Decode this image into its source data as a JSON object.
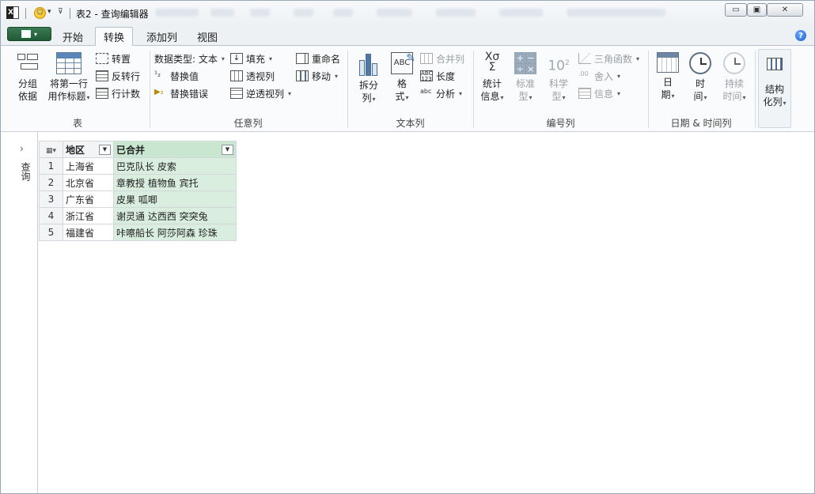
{
  "window": {
    "title": "表2 - 查询编辑器"
  },
  "tabs": [
    {
      "label": "开始"
    },
    {
      "label": "转换"
    },
    {
      "label": "添加列"
    },
    {
      "label": "视图"
    }
  ],
  "ribbon": {
    "table_group": {
      "label": "表",
      "group_by": "分组\n依据",
      "use_first_row_line1": "将第一行",
      "use_first_row_line2": "用作标题",
      "transpose": "转置",
      "reverse_rows": "反转行",
      "count_rows": "行计数"
    },
    "any_column_group": {
      "label": "任意列",
      "data_type": "数据类型: 文本",
      "replace_values": "替换值",
      "replace_errors": "替换错误",
      "fill": "填充",
      "pivot_column": "透视列",
      "unpivot_columns": "逆透视列",
      "rename": "重命名",
      "move": "移动"
    },
    "text_column_group": {
      "label": "文本列",
      "split_column_line1": "拆分",
      "split_column_line2": "列",
      "format_line1": "格",
      "format_line2": "式",
      "merge_columns": "合并列",
      "length": "长度",
      "parse": "分析"
    },
    "number_column_group": {
      "label": "编号列",
      "statistics_line1": "统计",
      "statistics_line2": "信息",
      "standard_line1": "标准",
      "standard_line2": "型",
      "scientific_line1": "科学",
      "scientific_line2": "型",
      "trigonometry": "三角函数",
      "rounding": "舍入",
      "information": "信息"
    },
    "datetime_group": {
      "label": "日期 & 时间列",
      "date_line1": "日",
      "date_line2": "期",
      "time_line1": "时",
      "time_line2": "间",
      "duration_line1": "持续",
      "duration_line2": "时间"
    },
    "structured_group": {
      "structured_line1": "结构",
      "structured_line2": "化列"
    }
  },
  "left_pane": {
    "label": "查询"
  },
  "table": {
    "columns": [
      "地区",
      "已合并"
    ],
    "rows": [
      {
        "num": "1",
        "region": "上海省",
        "merged": "巴克队长 皮索"
      },
      {
        "num": "2",
        "region": "北京省",
        "merged": "章教授 植物鱼 宾托"
      },
      {
        "num": "3",
        "region": "广东省",
        "merged": "皮果 呱唧"
      },
      {
        "num": "4",
        "region": "浙江省",
        "merged": "谢灵通 达西西 突突兔"
      },
      {
        "num": "5",
        "region": "福建省",
        "merged": "咔嚓船长 阿莎阿森 珍珠"
      }
    ]
  }
}
